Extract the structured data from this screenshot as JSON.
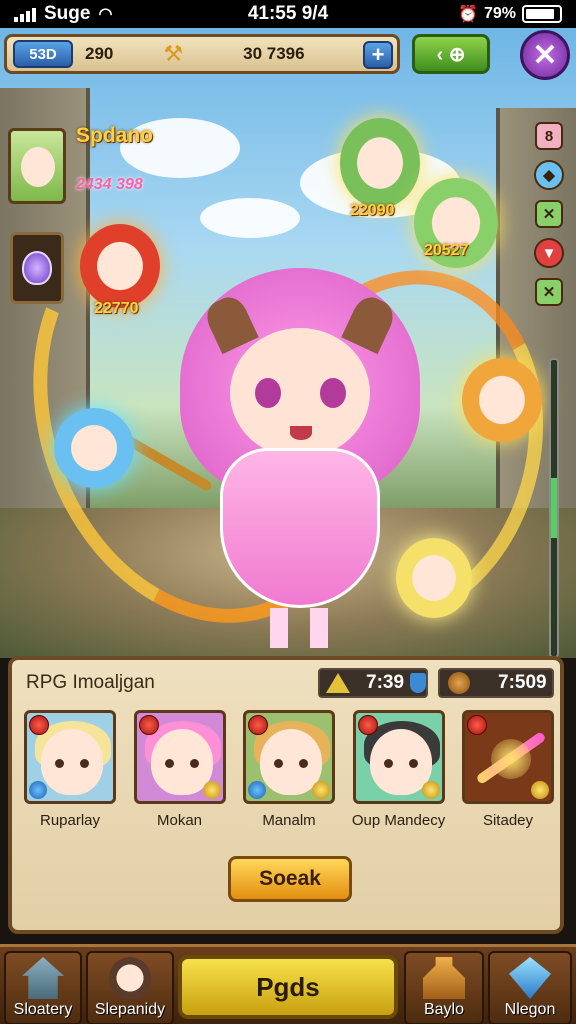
{
  "status_bar": {
    "carrier": "Suge",
    "time": "41:55 9/4",
    "battery": "79%"
  },
  "top_bar": {
    "level_badge": "53D",
    "resource_1": "290",
    "resource_2": "30 7396",
    "plus_label": "+",
    "nav_arrow": "‹ ⊕",
    "close_label": "✕"
  },
  "player": {
    "name": "Spdano",
    "power": "2434 398"
  },
  "side_buttons": [
    "8",
    "◆",
    "✕",
    "▼",
    "✕"
  ],
  "scene_characters": [
    {
      "power": "22090"
    },
    {
      "power": "20527"
    },
    {
      "power": "22770"
    }
  ],
  "party_panel": {
    "title": "RPG Imoaljgan",
    "timer_1": "7:39",
    "timer_2": "7:509",
    "heroes": [
      {
        "name": "Ruparlay",
        "hair": "#f5e49a",
        "bg": "#9fd0e6"
      },
      {
        "name": "Mokan",
        "hair": "#ff8fd6",
        "bg": "#d08ad6"
      },
      {
        "name": "Manalm",
        "hair": "#e6b25a",
        "bg": "#9ac070"
      },
      {
        "name": "Oup Mandecy",
        "hair": "#3a3a3a",
        "bg": "#7ad0a8"
      },
      {
        "name": "Sitadey",
        "hair": "#ff9a40",
        "bg": "#7a3a1a"
      }
    ],
    "summon_label": "Soeak"
  },
  "bottom_nav": {
    "items": [
      {
        "label": "Sloatery"
      },
      {
        "label": "Slepanidy"
      },
      {
        "label": "Baylo"
      },
      {
        "label": "Nlegon"
      }
    ],
    "main_button": "Pgds"
  }
}
